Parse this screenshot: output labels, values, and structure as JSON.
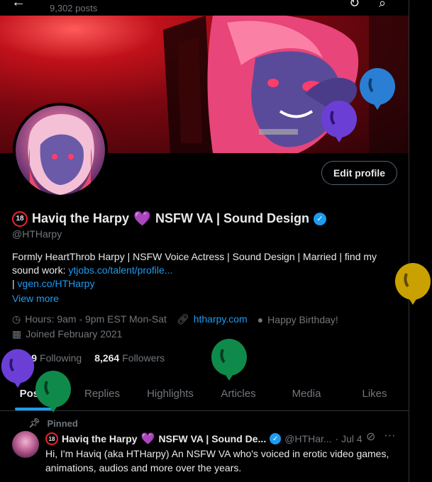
{
  "header": {
    "post_count": "9,302 posts",
    "back_icon": "arrow-left-icon",
    "refresh_icon": "refresh-icon",
    "search_icon": "search-icon"
  },
  "profile": {
    "age_badge": "18",
    "name_part1": "Haviq the Harpy",
    "heart": "💜",
    "name_part2": "NSFW VA | Sound Design",
    "handle": "@HTHarpy",
    "edit_button": "Edit profile",
    "bio_line1": "Formly HeartThrob Harpy | NSFW Voice Actress | Sound Design | Married | find my",
    "bio_line2_prefix": "sound work: ",
    "bio_link1": "ytjobs.co/talent/profile...",
    "bio_line3_prefix": "| ",
    "bio_link2": "vgen.co/HTHarpy",
    "view_more": "View more",
    "hours": "Hours: 9am - 9pm EST Mon-Sat",
    "website": "htharpy.com",
    "birthday": "Happy Birthday!",
    "joined": "Joined February 2021",
    "following_count": "1,219",
    "following_label": "Following",
    "followers_count": "8,264",
    "followers_label": "Followers"
  },
  "tabs": [
    {
      "label": "Posts",
      "active": true
    },
    {
      "label": "Replies",
      "active": false
    },
    {
      "label": "Highlights",
      "active": false
    },
    {
      "label": "Articles",
      "active": false
    },
    {
      "label": "Media",
      "active": false
    },
    {
      "label": "Likes",
      "active": false
    }
  ],
  "pinned_post": {
    "pinned_label": "Pinned",
    "author_name": "Haviq the Harpy",
    "author_name_rest": "NSFW VA | Sound De...",
    "author_handle": "@HTHar...",
    "date": "· Jul 4",
    "text": "Hi, I'm Haviq (aka HTHarpy) An NSFW VA who's voiced in erotic video games, animations, audios and more over the years."
  },
  "colors": {
    "accent": "#1d9bf0",
    "balloon_purple": "#6b3fd6",
    "balloon_green": "#0f8a4a",
    "balloon_yellow": "#c9a100",
    "balloon_blue": "#2a7fd4"
  }
}
